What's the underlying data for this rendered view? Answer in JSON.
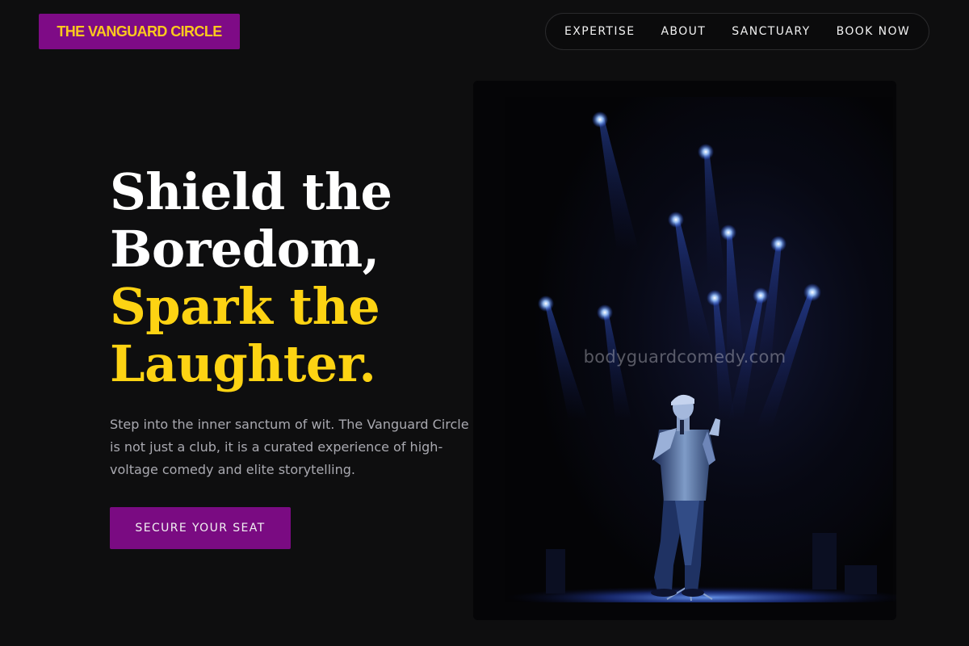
{
  "header": {
    "logo_text": "THE VANGUARD CIRCLE",
    "nav": [
      {
        "label": "EXPERTISE"
      },
      {
        "label": "ABOUT"
      },
      {
        "label": "SANCTUARY"
      },
      {
        "label": "BOOK NOW"
      }
    ]
  },
  "hero": {
    "headline_lines": [
      "Shield the",
      "Boredom,",
      "Spark the",
      "Laughter."
    ],
    "description": "Step into the inner sanctum of wit. The Vanguard Circle is not just a club, it is a curated experience of high-voltage comedy and elite storytelling.",
    "cta_label": "SECURE YOUR SEAT",
    "image": {
      "subject": "comedian performing on stage under blue spotlights",
      "watermark": "bodyguardcomedy.com"
    }
  },
  "colors": {
    "background": "#0e0e0f",
    "brand_purple": "#7e0b86",
    "accent_gold": "#fdd313",
    "text_muted": "#a9a9b0"
  }
}
